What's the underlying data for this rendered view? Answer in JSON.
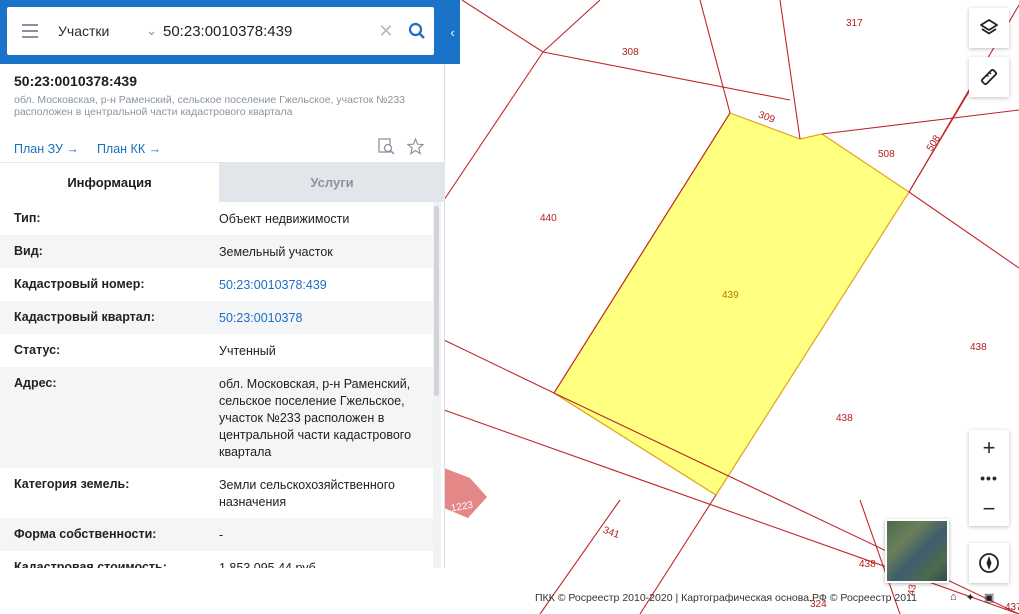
{
  "search": {
    "layer": "Участки",
    "value": "50:23:0010378:439"
  },
  "object": {
    "title": "50:23:0010378:439",
    "subtitle": "обл. Московская, р-н Раменский, сельское поселение Гжельское, участок №233 расположен в центральной части кадастрового квартала"
  },
  "plans": {
    "plan_zu": "План ЗУ →",
    "plan_kk": "План КК →"
  },
  "tabs": {
    "info": "Информация",
    "services": "Услуги"
  },
  "info_rows": [
    {
      "label": "Тип:",
      "value": "Объект недвижимости"
    },
    {
      "label": "Вид:",
      "value": "Земельный участок"
    },
    {
      "label": "Кадастровый номер:",
      "value": "50:23:0010378:439"
    },
    {
      "label": "Кадастровый квартал:",
      "value": "50:23:0010378"
    },
    {
      "label": "Статус:",
      "value": "Учтенный"
    },
    {
      "label": "Адрес:",
      "value": "обл. Московская, р-н Раменский, сельское поселение Гжельское, участок №233 расположен в центральной части кадастрового квартала"
    },
    {
      "label": "Категория земель:",
      "value": "Земли сельскохозяйственного назначения"
    },
    {
      "label": "Форма собственности:",
      "value": "-"
    },
    {
      "label": "Кадастровая стоимость:",
      "value": "1 853 095,44 руб."
    }
  ],
  "map": {
    "labels": {
      "p317": "317",
      "p308": "308",
      "p309": "309",
      "p508a": "508",
      "p508b": "508",
      "p440": "440",
      "p439": "439",
      "p438a": "438",
      "p438b": "438",
      "p438c": "438",
      "p341": "341",
      "p1223": "1223",
      "p437a": "437",
      "p437b": "437",
      "p324": "324"
    },
    "zoom_dots": "•••",
    "attribution": "ПКК © Росреестр 2010-2020 | Картографическая основа.РФ © Росреестр 2011"
  },
  "colors": {
    "header_blue": "#1a73c9",
    "link_blue": "#1a6fc0",
    "parcel_line": "#c0262c",
    "selected_fill": "#ffff80"
  }
}
